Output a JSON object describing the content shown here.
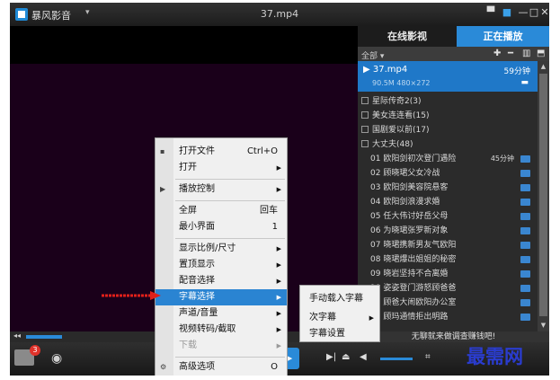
{
  "titlebar": {
    "app_name": "暴风影音",
    "app_dropdown": "▾",
    "window_title": "37.mp4"
  },
  "panel": {
    "tabs": [
      "在线影视",
      "正在播放"
    ],
    "playlist_filter": "全部 ▾",
    "now_playing": {
      "name": "▶ 37.mp4",
      "duration": "59分钟",
      "meta": "90.5M   480×272"
    },
    "groups": [
      "星际传奇2(3)",
      "美女连连看(15)",
      "国剧爱以前(17)",
      "大丈夫(48)"
    ],
    "episodes": [
      {
        "title": "01 欧阳剑初次登门遇险",
        "duration": "45分钟"
      },
      {
        "title": "02 顾晓珺父女冷战",
        "duration": ""
      },
      {
        "title": "03 欧阳剑美容院悬客",
        "duration": ""
      },
      {
        "title": "04 欧阳剑浪漫求婚",
        "duration": ""
      },
      {
        "title": "05 任大伟讨好岳父母",
        "duration": ""
      },
      {
        "title": "06 为晓珺张罗新对象",
        "duration": ""
      },
      {
        "title": "07 晓珺携新男友气欧阳",
        "duration": ""
      },
      {
        "title": "08 晓珺爆出姐姐的秘密",
        "duration": ""
      },
      {
        "title": "09 晓岩坚持不合离婚",
        "duration": ""
      },
      {
        "title": "10 姿姿登门游怒顾爸爸",
        "duration": ""
      },
      {
        "title": "11 顾爸大闹欧阳办公室",
        "duration": ""
      },
      {
        "title": "12 顾玛通情拒出明路",
        "duration": ""
      }
    ],
    "marquee": "无聊就来做调查赚钱吧!"
  },
  "controls": {
    "notification_count": "3"
  },
  "watermark": "最需网",
  "context_menu": {
    "items": [
      {
        "label": "打开文件",
        "shortcut": "Ctrl+O",
        "arrow": "",
        "icon": "▪",
        "state": "normal"
      },
      {
        "label": "打开",
        "shortcut": "",
        "arrow": "▶",
        "icon": "",
        "state": "normal"
      },
      {
        "label": "播放控制",
        "shortcut": "",
        "arrow": "▶",
        "icon": "▶",
        "state": "normal"
      },
      {
        "label": "全屏",
        "shortcut": "回车",
        "arrow": "",
        "icon": "",
        "state": "normal"
      },
      {
        "label": "最小界面",
        "shortcut": "1",
        "arrow": "",
        "icon": "",
        "state": "normal"
      },
      {
        "label": "显示比例/尺寸",
        "shortcut": "",
        "arrow": "▶",
        "icon": "",
        "state": "normal"
      },
      {
        "label": "置顶显示",
        "shortcut": "",
        "arrow": "▶",
        "icon": "",
        "state": "normal"
      },
      {
        "label": "配音选择",
        "shortcut": "",
        "arrow": "▶",
        "icon": "",
        "state": "normal"
      },
      {
        "label": "字幕选择",
        "shortcut": "",
        "arrow": "▶",
        "icon": "",
        "state": "highlighted"
      },
      {
        "label": "声道/音量",
        "shortcut": "",
        "arrow": "▶",
        "icon": "",
        "state": "normal"
      },
      {
        "label": "视频转码/截取",
        "shortcut": "",
        "arrow": "▶",
        "icon": "",
        "state": "normal"
      },
      {
        "label": "下载",
        "shortcut": "",
        "arrow": "▶",
        "icon": "",
        "state": "disabled"
      },
      {
        "label": "高级选项",
        "shortcut": "O",
        "arrow": "",
        "icon": "⚙",
        "state": "normal"
      }
    ]
  },
  "submenu": {
    "items": [
      {
        "label": "手动载入字幕",
        "arrow": ""
      },
      {
        "label": "次字幕",
        "arrow": "▶"
      },
      {
        "label": "字幕设置",
        "arrow": ""
      }
    ]
  },
  "colors": {
    "accent": "#2a8ad8",
    "menu_highlight": "#2a84d2",
    "arrow_red": "#e0201a",
    "watermark": "#2a3ccf"
  }
}
